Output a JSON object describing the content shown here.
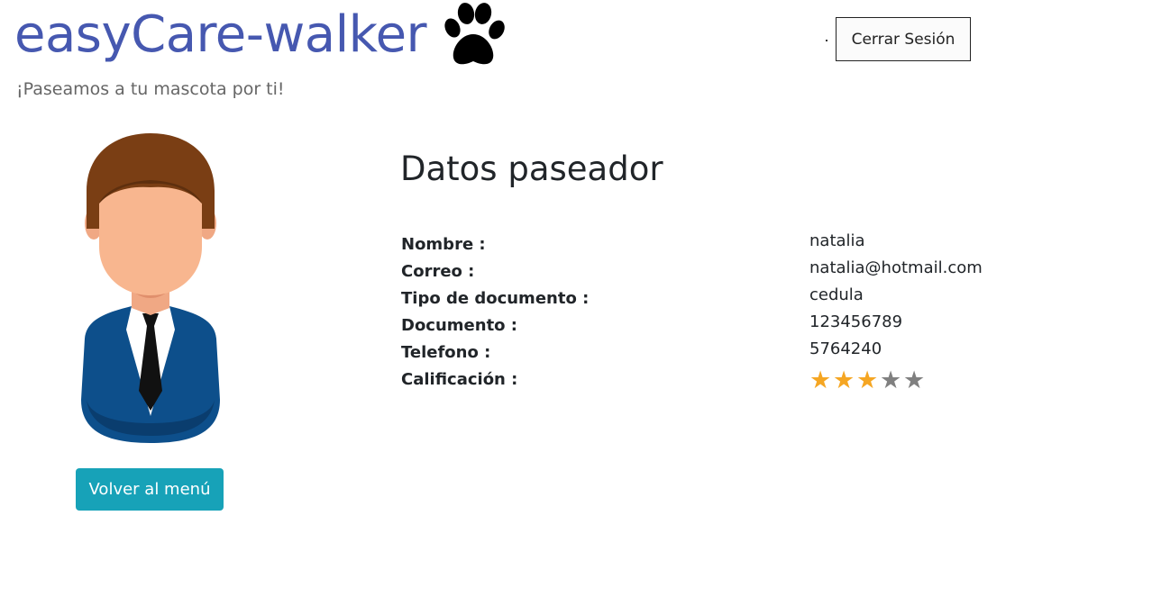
{
  "header": {
    "brand_title": "easyCare-walker",
    "paw_icon": "paw-icon",
    "tagline": "¡Paseamos a tu mascota por ti!",
    "logout_label": "Cerrar Sesión"
  },
  "profile": {
    "avatar_icon": "walker-avatar",
    "back_label": "Volver al menú"
  },
  "details": {
    "title": "Datos paseador",
    "fields": [
      {
        "label": "Nombre :",
        "value": "natalia"
      },
      {
        "label": "Correo :",
        "value": "natalia@hotmail.com"
      },
      {
        "label": "Tipo de documento :",
        "value": "cedula"
      },
      {
        "label": "Documento :",
        "value": "123456789"
      },
      {
        "label": "Telefono :",
        "value": "5764240"
      },
      {
        "label": "Calificación :",
        "rating": 3,
        "max": 5
      }
    ]
  },
  "colors": {
    "brand": "#4658b0",
    "back_button": "#17a2b8",
    "star_filled": "#f5a623",
    "star_empty": "#808080"
  }
}
